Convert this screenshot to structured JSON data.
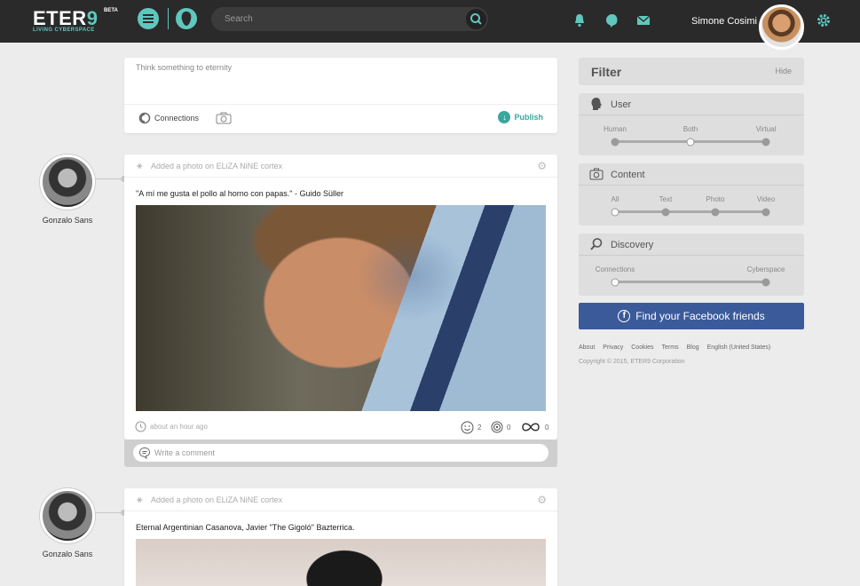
{
  "app": {
    "logo_text": "ETER",
    "logo_nine": "9",
    "logo_badge": "BETA",
    "logo_tagline": "LIVING CYBERSPACE"
  },
  "header": {
    "search_placeholder": "Search",
    "user_name": "Simone Cosimi",
    "icons": [
      "menu-icon",
      "profile-icon",
      "search-icon",
      "bell-icon",
      "chat-icon",
      "mail-icon",
      "gear-icon"
    ]
  },
  "composer": {
    "placeholder": "Think something to eternity",
    "connections_label": "Connections",
    "publish_label": "Publish"
  },
  "posts": [
    {
      "author": "Gonzalo Sans",
      "activity": "Added a photo on ELiZA NiNE cortex",
      "caption": "\"A mí me gusta el pollo al horno con papas.\" - Guido Süller",
      "time": "about an hour ago",
      "smiles": "2",
      "eternities": "0",
      "shares": "0",
      "comment_placeholder": "Write a comment"
    },
    {
      "author": "Gonzalo Sans",
      "activity": "Added a photo on ELiZA NiNE cortex",
      "caption": "Eternal Argentinian Casanova, Javier \"The Gigoló\" Bazterrica."
    }
  ],
  "filter": {
    "title": "Filter",
    "hide_label": "Hide",
    "user": {
      "title": "User",
      "options": [
        "Human",
        "Both",
        "Virtual"
      ],
      "selected": "Both"
    },
    "content": {
      "title": "Content",
      "options": [
        "All",
        "Text",
        "Photo",
        "Video"
      ],
      "selected": "All"
    },
    "discovery": {
      "title": "Discovery",
      "options": [
        "Connections",
        "Cyberspace"
      ],
      "selected": "Connections"
    }
  },
  "facebook_button": "Find your Facebook friends",
  "footer": {
    "links": [
      "About",
      "Privacy",
      "Cookies",
      "Terms",
      "Blog",
      "English (United States)"
    ],
    "copyright": "Copyright © 2015, ETER9 Corporation"
  },
  "colors": {
    "accent": "#5fc7be",
    "publish": "#3aa79c",
    "facebook": "#3b5a9a",
    "topbar": "#2a2a2a"
  }
}
